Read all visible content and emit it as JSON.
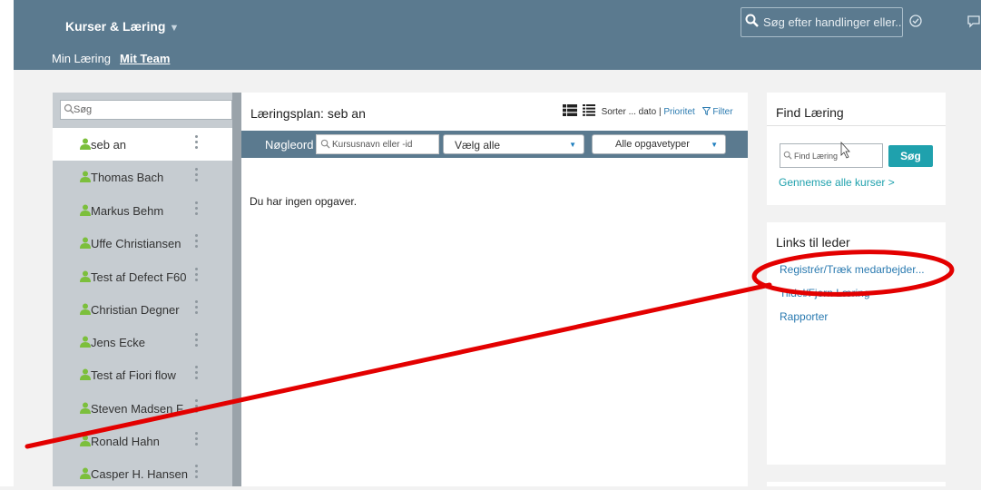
{
  "shell": {
    "app_title": "Kurser & Læring",
    "search_placeholder": "Søg efter handlinger eller...",
    "subnav": [
      "Min Læring",
      "Mit Team"
    ]
  },
  "team": {
    "search_placeholder": "Søg",
    "members": [
      "seb an",
      "Thomas Bach",
      "Markus Behm",
      "Uffe Christiansen",
      "Test af Defect F60",
      "Christian Degner",
      "Jens Ecke",
      "Test af Fiori flow",
      "Steven Madsen F...",
      "Ronald Hahn",
      "Casper H. Hansen"
    ]
  },
  "learning_plan": {
    "title": "Læringsplan: seb an",
    "sort_label": "Sorter ... dato",
    "sort_separator": "|",
    "priority_link": "Prioritet",
    "filter_link": "Filter",
    "keyword_label": "Nøgleord",
    "keyword_placeholder": "Kursusnavn eller -id",
    "select_all": "Vælg alle",
    "task_types": "Alle opgavetyper",
    "empty_message": "Du har ingen opgaver."
  },
  "find_learning": {
    "title": "Find Læring",
    "input_placeholder": "Find Læring",
    "search_button": "Søg",
    "browse_link": "Gennemse alle kurser >"
  },
  "manager_links": {
    "title": "Links til leder",
    "items": [
      "Registrér/Træk medarbejder...",
      "Tildel/Fjern Læring",
      "Rapporter"
    ]
  },
  "colors": {
    "shell": "#5b7a8f",
    "accent_teal": "#1fa1ad",
    "annotation_red": "#e30000",
    "person_icon": "#7cbf3c"
  }
}
